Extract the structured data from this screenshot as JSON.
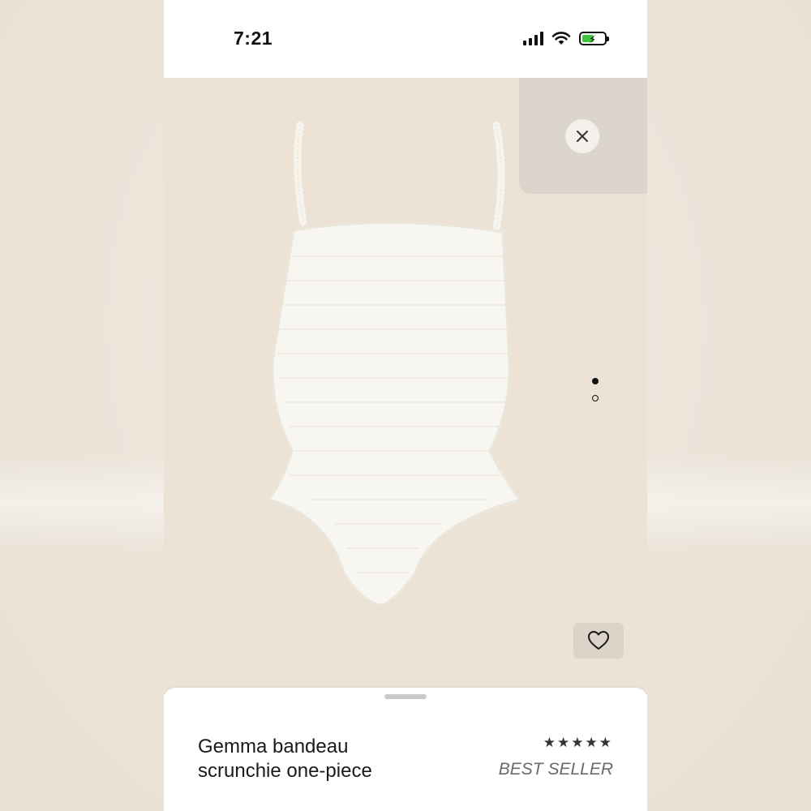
{
  "status_bar": {
    "time": "7:21",
    "signal_icon": "cellular-signal-icon",
    "wifi_icon": "wifi-icon",
    "battery_icon": "battery-charging-icon"
  },
  "gallery": {
    "image_alt": "white textured bandeau one-piece swimsuit",
    "close_icon": "close-icon",
    "page_count": 2,
    "current_page": 1,
    "wishlist_icon": "heart-icon"
  },
  "product": {
    "title": "Gemma bandeau scrunchie one-piece",
    "rating_stars": "★★★★★",
    "badge": "BEST SELLER"
  },
  "colors": {
    "image_background": "#ece3d6",
    "close_panel": "#dcd5cb",
    "badge_text": "#6b6b6b"
  }
}
